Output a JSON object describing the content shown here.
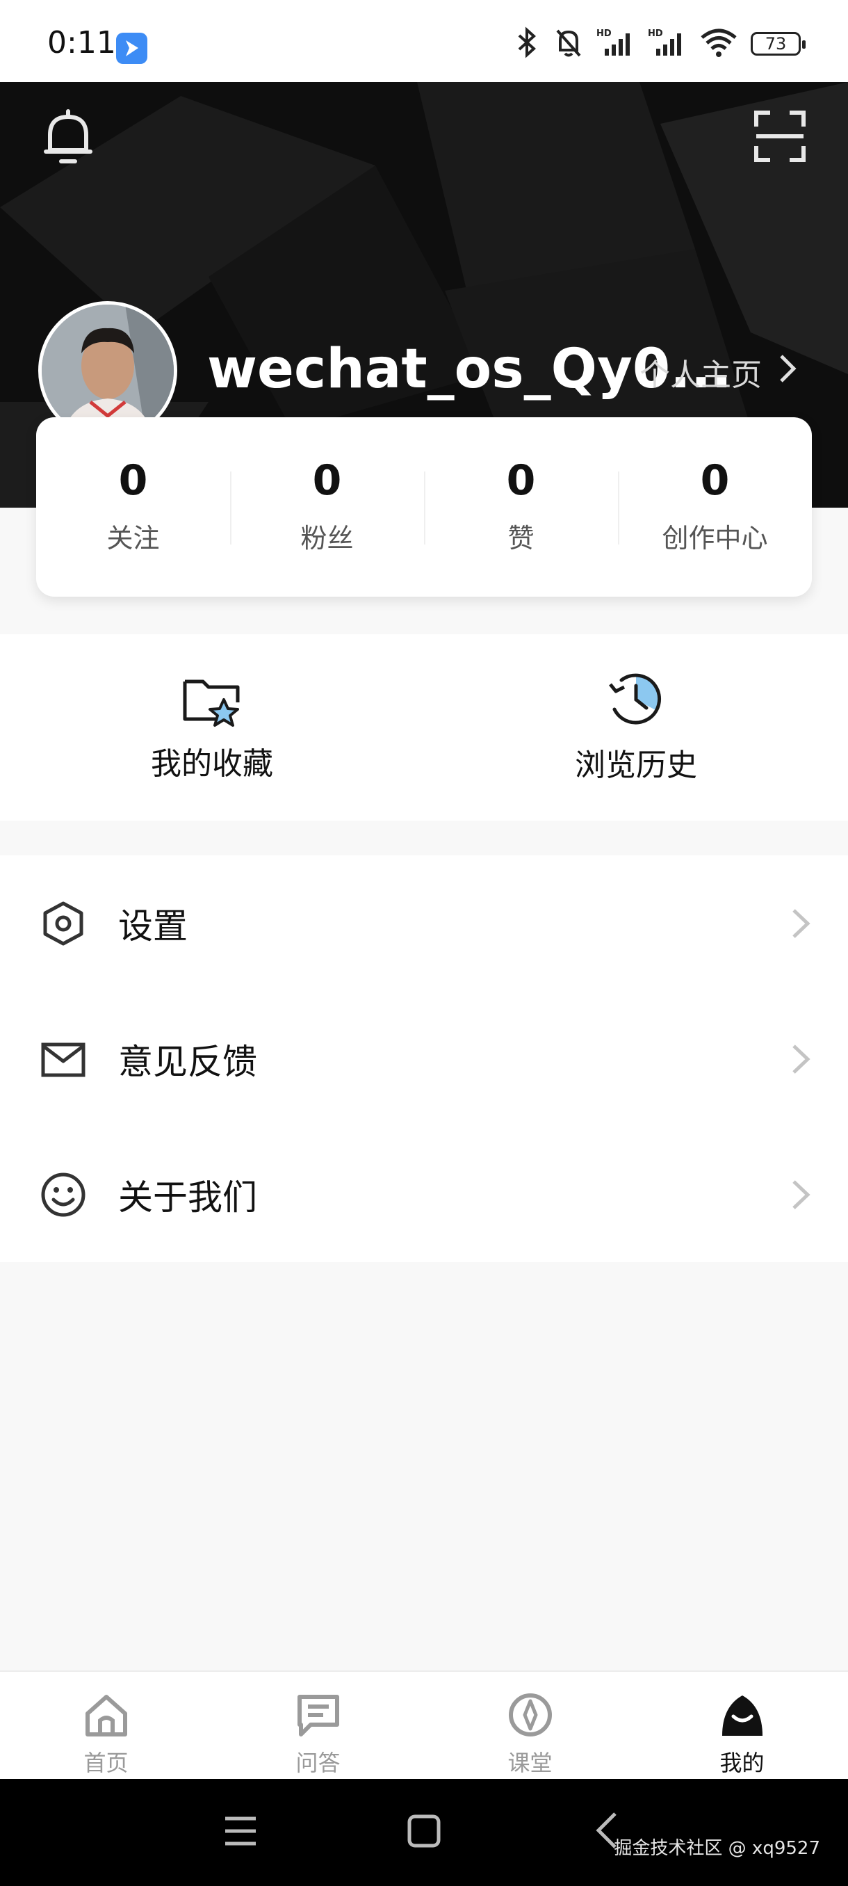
{
  "status_bar": {
    "time": "0:11",
    "battery": "73"
  },
  "profile": {
    "username": "wechat_os_Qy0...",
    "homepage_label": "个人主页"
  },
  "stats": [
    {
      "value": "0",
      "label": "关注"
    },
    {
      "value": "0",
      "label": "粉丝"
    },
    {
      "value": "0",
      "label": "赞"
    },
    {
      "value": "0",
      "label": "创作中心"
    }
  ],
  "quick_actions": [
    {
      "label": "我的收藏",
      "icon": "star-folder-icon"
    },
    {
      "label": "浏览历史",
      "icon": "history-clock-icon"
    }
  ],
  "menu": [
    {
      "label": "设置",
      "icon": "gear-hexagon-icon"
    },
    {
      "label": "意见反馈",
      "icon": "mail-icon"
    },
    {
      "label": "关于我们",
      "icon": "smiley-icon"
    }
  ],
  "tabs": [
    {
      "label": "首页",
      "icon": "home-icon"
    },
    {
      "label": "问答",
      "icon": "chat-icon"
    },
    {
      "label": "课堂",
      "icon": "compass-icon"
    },
    {
      "label": "我的",
      "icon": "profile-icon",
      "active": true
    }
  ],
  "watermark": "掘金技术社区 @ xq9527",
  "colors": {
    "header_bg": "#0e0e0e",
    "accent_blue": "#3d8cf5",
    "icon_blue": "#8cc8f0",
    "page_bg": "#f8f8f8"
  }
}
